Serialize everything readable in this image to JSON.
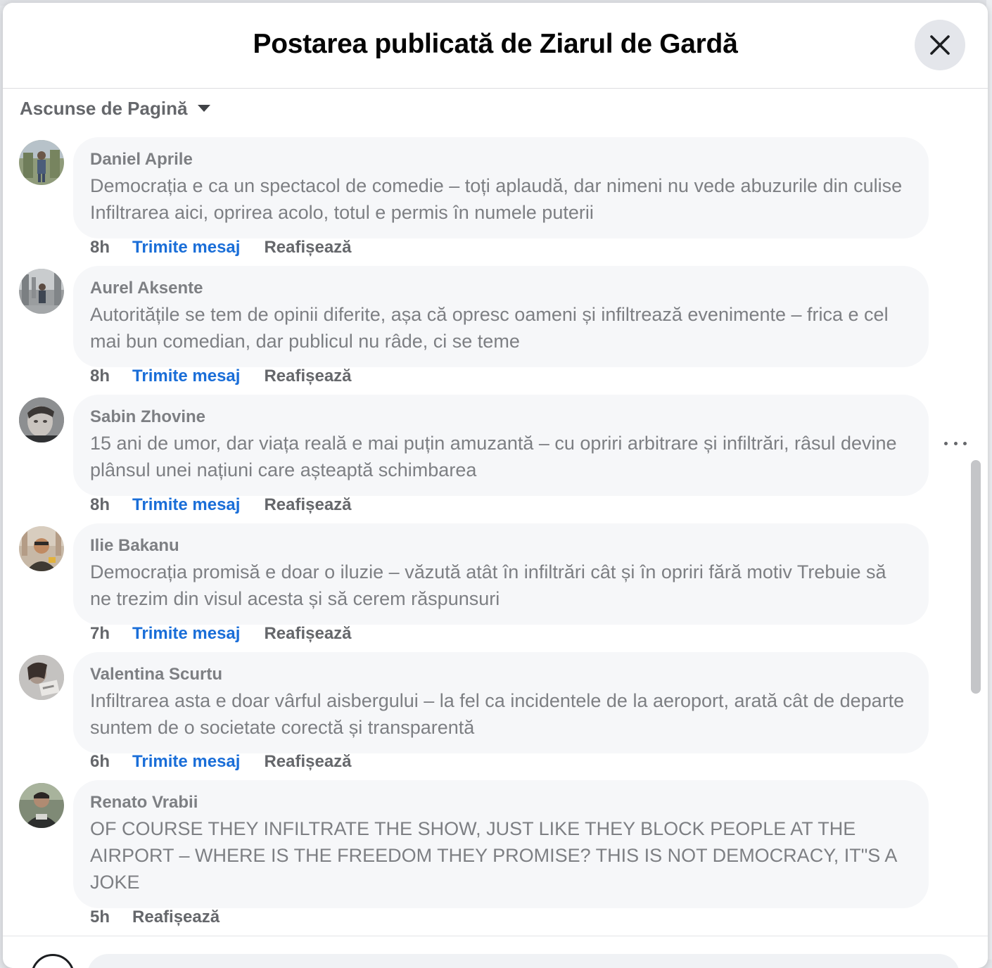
{
  "header": {
    "title": "Postarea publicată de Ziarul de Gardă",
    "close_label": "Close"
  },
  "filter": {
    "label": "Ascunse de Pagină"
  },
  "actions": {
    "message_label": "Trimite mesaj",
    "unhide_label": "Reafișează"
  },
  "comments": [
    {
      "author": "Daniel Aprile",
      "text": "Democrația e ca un spectacol de comedie – toți aplaudă, dar nimeni nu vede abuzurile din culise Infiltrarea aici, oprirea acolo, totul e permis în numele puterii",
      "time": "8h"
    },
    {
      "author": "Aurel Aksente",
      "text": "Autoritățile se tem de opinii diferite, așa că opresc oameni și infiltrează evenimente – frica e cel mai bun comedian, dar publicul nu râde, ci se teme",
      "time": "8h"
    },
    {
      "author": "Sabin Zhovine",
      "text": "15 ani de umor, dar viața reală e mai puțin amuzantă – cu opriri arbitrare și infiltrări, râsul devine plânsul unei națiuni care așteaptă schimbarea",
      "time": "8h"
    },
    {
      "author": "Ilie Bakanu",
      "text": "Democrația promisă e doar o iluzie – văzută atât în infiltrări cât și în opriri fără motiv Trebuie să ne trezim din visul acesta și să cerem răspunsuri",
      "time": "7h"
    },
    {
      "author": "Valentina Scurtu",
      "text": "Infiltrarea asta e doar vârful aisbergului – la fel ca incidentele de la aeroport, arată cât de departe suntem de o societate corectă și transparentă",
      "time": "6h"
    },
    {
      "author": "Renato Vrabii",
      "text": "OF COURSE THEY INFILTRATE THE SHOW, JUST LIKE THEY BLOCK PEOPLE AT THE AIRPORT – WHERE IS THE FREEDOM THEY PROMISE? THIS IS NOT DEMOCRACY, IT\"S A JOKE",
      "time": "5h"
    }
  ],
  "colors": {
    "link_blue": "#1a6ed8",
    "muted_text": "#65676b",
    "bubble_bg": "#f6f7f9",
    "title_text": "#050505"
  },
  "icons": {
    "close": "close-icon",
    "caret": "caret-down-icon",
    "more": "more-options-icon"
  }
}
